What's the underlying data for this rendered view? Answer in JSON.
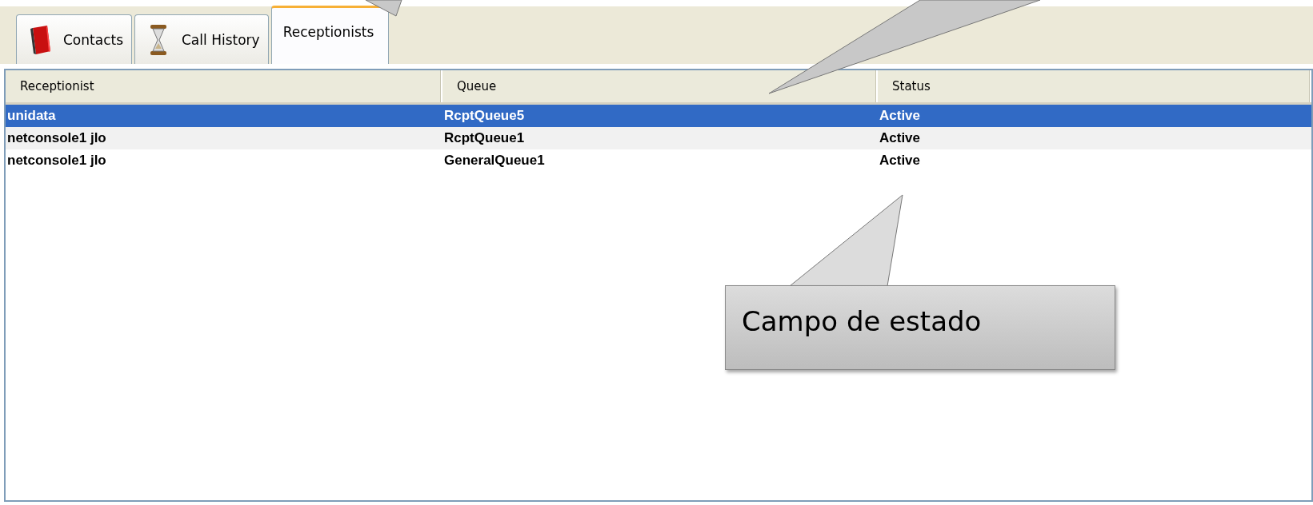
{
  "tabs": [
    {
      "label": "Contacts",
      "kind": "book",
      "selected": false
    },
    {
      "label": "Call History",
      "kind": "hourglass",
      "selected": false
    },
    {
      "label": "Receptionists",
      "kind": "none",
      "selected": true
    }
  ],
  "table": {
    "columns": [
      "Receptionist",
      "Queue",
      "Status"
    ],
    "rows": [
      {
        "cells": [
          "unidata",
          "RcptQueue5",
          "Active"
        ],
        "selected": true
      },
      {
        "cells": [
          "netconsole1 jlo",
          "RcptQueue1",
          "Active"
        ],
        "selected": false
      },
      {
        "cells": [
          "netconsole1 jlo",
          "GeneralQueue1",
          "Active"
        ],
        "selected": false
      }
    ]
  },
  "callout": {
    "text": "Campo de estado"
  }
}
